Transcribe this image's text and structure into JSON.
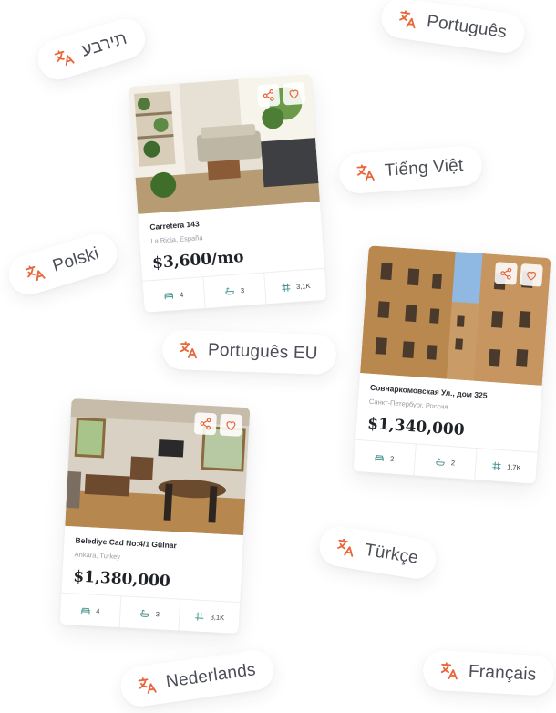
{
  "languages": {
    "hebrew": "תירבע",
    "portuguese": "Português",
    "vietnamese": "Tiếng Việt",
    "polish": "Polski",
    "portuguese_eu": "Português EU",
    "turkish": "Türkçe",
    "dutch": "Nederlands",
    "french": "Français"
  },
  "icons": {
    "language": "translate-icon",
    "share": "share-icon",
    "favorite": "heart-icon",
    "bedrooms": "bed-icon",
    "bathrooms": "bath-icon",
    "area": "area-icon"
  },
  "colors": {
    "accent": "#e8663a",
    "spec_icon": "#3f8f8a",
    "text": "#4b4e57"
  },
  "listings": [
    {
      "address": "Carretera 143",
      "city": "La Rioja, España",
      "price": "$3,600/mo",
      "beds": "4",
      "baths": "3",
      "area": "3,1K"
    },
    {
      "address": "Совнаркомовская Ул., дом 325",
      "city": "Санкт-Петербург, Россия",
      "price": "$1,340,000",
      "beds": "2",
      "baths": "2",
      "area": "1,7K"
    },
    {
      "address": "Belediye Cad No:4/1 Gülnar",
      "city": "Ankara, Turkey",
      "price": "$1,380,000",
      "beds": "4",
      "baths": "3",
      "area": "3,1K"
    }
  ]
}
